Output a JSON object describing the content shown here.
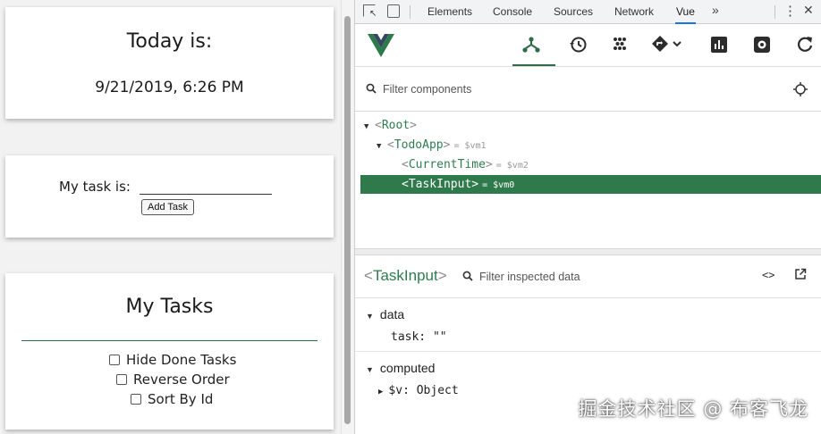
{
  "app": {
    "time_card": {
      "title": "Today is:",
      "datetime": "9/21/2019, 6:26 PM"
    },
    "input_card": {
      "label": "My task is:",
      "input_value": "",
      "button_label": "Add Task"
    },
    "tasks_card": {
      "title": "My Tasks",
      "options": [
        {
          "label": "Hide Done Tasks",
          "checked": false
        },
        {
          "label": "Reverse Order",
          "checked": false
        },
        {
          "label": "Sort By Id",
          "checked": false
        }
      ]
    }
  },
  "devtools": {
    "tabs": [
      "Elements",
      "Console",
      "Sources",
      "Network",
      "Vue"
    ],
    "active_tab": "Vue",
    "more_label": "»",
    "vue_toolbar": {
      "tools": [
        "components-icon",
        "timeline-icon",
        "vuex-icon",
        "routing-icon",
        "performance-icon",
        "settings-icon",
        "refresh-icon"
      ],
      "active_tool": "components-icon"
    },
    "component_filter": {
      "placeholder": "Filter components"
    },
    "tree": [
      {
        "name": "Root",
        "ref": "",
        "expanded": true,
        "selected": false
      },
      {
        "name": "TodoApp",
        "ref": "= $vm1",
        "expanded": true,
        "selected": false
      },
      {
        "name": "CurrentTime",
        "ref": "= $vm2",
        "expanded": false,
        "selected": false
      },
      {
        "name": "TaskInput",
        "ref": "= $vm0",
        "expanded": false,
        "selected": true
      }
    ],
    "inspector": {
      "component": "TaskInput",
      "filter_placeholder": "Filter inspected data",
      "code_icon": "<>",
      "sections": {
        "data": {
          "label": "data",
          "props": [
            {
              "key": "task:",
              "value": "\"\""
            }
          ]
        },
        "computed": {
          "label": "computed",
          "props": [
            {
              "key": "$v:",
              "value": "Object"
            }
          ]
        }
      }
    },
    "accent_color": "#2f7a4b"
  },
  "watermark": "掘金技术社区 @ 布客飞龙"
}
